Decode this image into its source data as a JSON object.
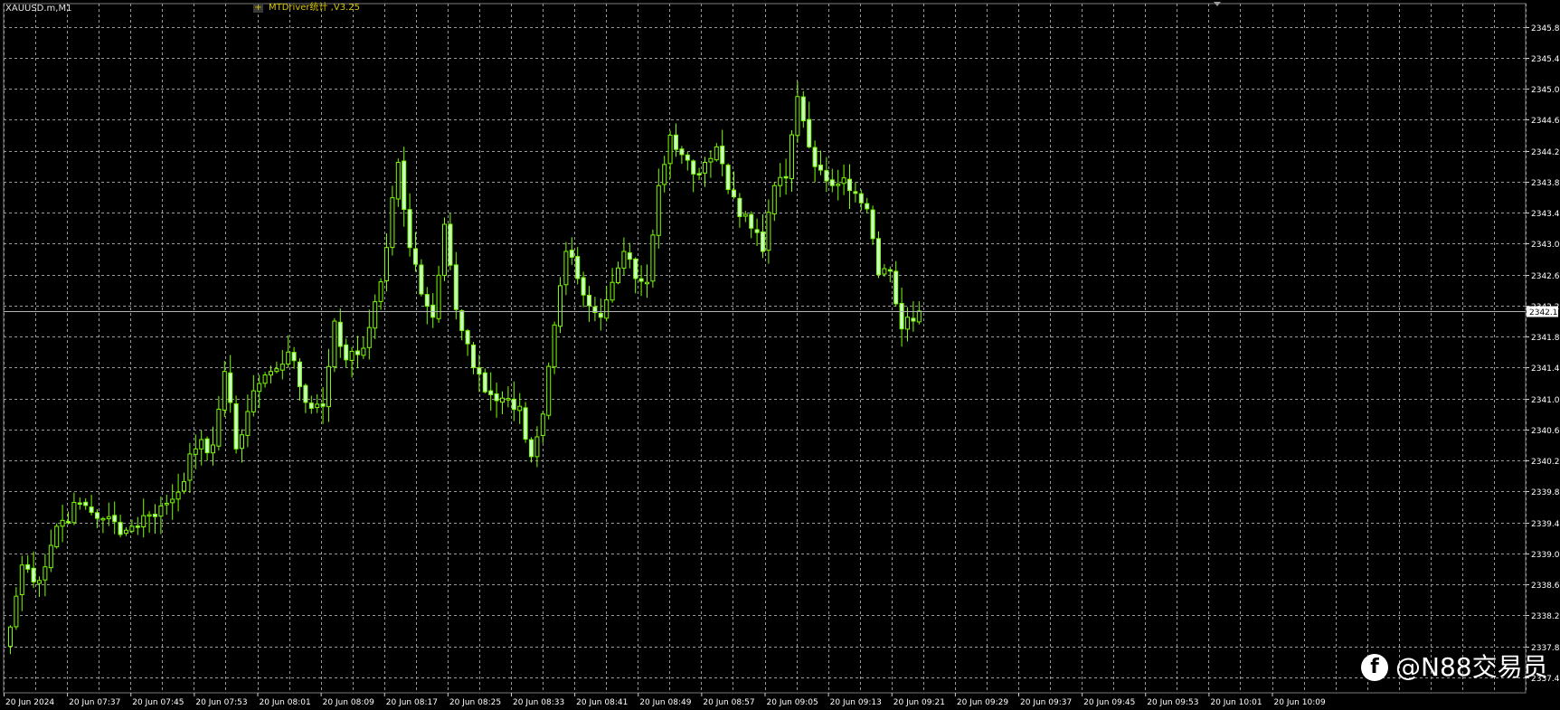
{
  "header": {
    "symbol_timeframe": "XAUUSD.m,M1",
    "indicator_label": "MTDriver统计 ,V3.25",
    "indicator_toggle": "+"
  },
  "watermark": {
    "icon_glyph": "f",
    "text": "@N88交易员"
  },
  "colors": {
    "background": "#000000",
    "grid": "#9a9a9a",
    "candle": "#c8ffc8",
    "wick": "#7CFC00",
    "axis_text": "#ffffff",
    "price_line": "#b4b4b4"
  },
  "chart_data": {
    "type": "candlestick",
    "symbol": "XAUUSD.m",
    "timeframe": "M1",
    "ylim": [
      2337.25,
      2346.15
    ],
    "y_ticks": [
      "2345.85",
      "2345.45",
      "2345.05",
      "2344.65",
      "2344.25",
      "2343.85",
      "2343.45",
      "2343.05",
      "2342.65",
      "2342.25",
      "2341.85",
      "2341.45",
      "2341.05",
      "2340.65",
      "2340.25",
      "2339.85",
      "2339.45",
      "2339.05",
      "2338.65",
      "2338.25",
      "2337.85",
      "2337.45"
    ],
    "x_tick_labels": [
      "20 Jun 2024",
      "20 Jun 07:37",
      "20 Jun 07:45",
      "20 Jun 07:53",
      "20 Jun 08:01",
      "20 Jun 08:09",
      "20 Jun 08:17",
      "20 Jun 08:25",
      "20 Jun 08:33",
      "20 Jun 08:41",
      "20 Jun 08:49",
      "20 Jun 08:57",
      "20 Jun 09:05",
      "20 Jun 09:13",
      "20 Jun 09:21",
      "20 Jun 09:29",
      "20 Jun 09:37",
      "20 Jun 09:45",
      "20 Jun 09:53",
      "20 Jun 10:01",
      "20 Jun 10:09"
    ],
    "current_price": "2342.18",
    "grid": true,
    "close_anchors": [
      [
        0,
        2338.1
      ],
      [
        2,
        2338.9
      ],
      [
        5,
        2338.7
      ],
      [
        8,
        2339.4
      ],
      [
        12,
        2339.7
      ],
      [
        16,
        2339.5
      ],
      [
        20,
        2339.35
      ],
      [
        24,
        2339.55
      ],
      [
        28,
        2339.75
      ],
      [
        32,
        2340.4
      ],
      [
        35,
        2340.45
      ],
      [
        37,
        2341.4
      ],
      [
        39,
        2340.4
      ],
      [
        42,
        2341.15
      ],
      [
        45,
        2341.4
      ],
      [
        48,
        2341.65
      ],
      [
        51,
        2341.0
      ],
      [
        54,
        2340.95
      ],
      [
        56,
        2342.05
      ],
      [
        58,
        2341.55
      ],
      [
        61,
        2341.7
      ],
      [
        63,
        2342.3
      ],
      [
        65,
        2343.0
      ],
      [
        67,
        2344.1
      ],
      [
        69,
        2343.0
      ],
      [
        71,
        2342.4
      ],
      [
        73,
        2342.1
      ],
      [
        75,
        2343.3
      ],
      [
        77,
        2342.2
      ],
      [
        80,
        2341.45
      ],
      [
        83,
        2341.1
      ],
      [
        86,
        2341.05
      ],
      [
        88,
        2340.95
      ],
      [
        90,
        2340.3
      ],
      [
        92,
        2340.85
      ],
      [
        94,
        2342.0
      ],
      [
        96,
        2342.95
      ],
      [
        98,
        2342.6
      ],
      [
        100,
        2342.25
      ],
      [
        102,
        2342.1
      ],
      [
        104,
        2342.55
      ],
      [
        106,
        2342.95
      ],
      [
        108,
        2342.6
      ],
      [
        110,
        2342.55
      ],
      [
        112,
        2343.8
      ],
      [
        114,
        2344.45
      ],
      [
        116,
        2344.2
      ],
      [
        118,
        2343.95
      ],
      [
        120,
        2344.1
      ],
      [
        122,
        2344.3
      ],
      [
        124,
        2343.75
      ],
      [
        126,
        2343.4
      ],
      [
        128,
        2343.25
      ],
      [
        130,
        2342.95
      ],
      [
        132,
        2343.8
      ],
      [
        134,
        2343.9
      ],
      [
        136,
        2344.95
      ],
      [
        138,
        2344.3
      ],
      [
        140,
        2344.0
      ],
      [
        142,
        2343.8
      ],
      [
        144,
        2343.9
      ],
      [
        146,
        2343.7
      ],
      [
        148,
        2343.5
      ],
      [
        150,
        2342.65
      ],
      [
        152,
        2342.7
      ],
      [
        154,
        2341.95
      ],
      [
        156,
        2342.05
      ],
      [
        157,
        2342.18
      ]
    ]
  }
}
